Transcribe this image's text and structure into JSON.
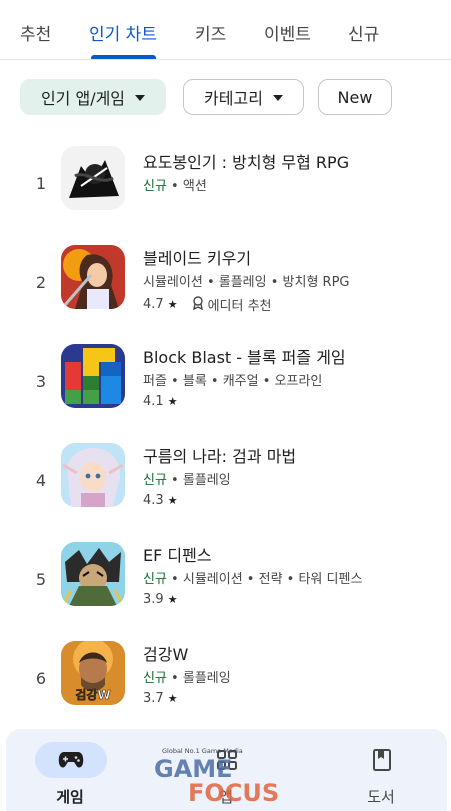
{
  "tabs": [
    {
      "label": "추천"
    },
    {
      "label": "인기 차트"
    },
    {
      "label": "키즈"
    },
    {
      "label": "이벤트"
    },
    {
      "label": "신규"
    }
  ],
  "filters": {
    "category_chip": "인기 앱/게임",
    "category_dropdown": "카테고리",
    "new_chip": "New"
  },
  "apps": [
    {
      "rank": "1",
      "title": "요도봉인기 : 방치형 무협 RPG",
      "tags": [
        "신규",
        "액션"
      ],
      "is_new": true
    },
    {
      "rank": "2",
      "title": "블레이드 키우기",
      "tags": [
        "시뮬레이션",
        "롤플레잉",
        "방치형 RPG"
      ],
      "is_new": false,
      "rating": "4.7",
      "badge": "에디터 추천"
    },
    {
      "rank": "3",
      "title": "Block Blast - 블록 퍼즐 게임",
      "tags": [
        "퍼즐",
        "블록",
        "캐주얼",
        "오프라인"
      ],
      "is_new": false,
      "rating": "4.1"
    },
    {
      "rank": "4",
      "title": "구름의 나라: 검과 마법",
      "tags": [
        "신규",
        "롤플레잉"
      ],
      "is_new": true,
      "rating": "4.3"
    },
    {
      "rank": "5",
      "title": "EF 디펜스",
      "tags": [
        "신규",
        "시뮬레이션",
        "전략",
        "타워 디펜스"
      ],
      "is_new": true,
      "rating": "3.9"
    },
    {
      "rank": "6",
      "title": "검강W",
      "tags": [
        "신규",
        "롤플레잉"
      ],
      "is_new": true,
      "rating": "3.7"
    }
  ],
  "icon6_text": "검강W",
  "bottom_nav": [
    {
      "label": "게임",
      "icon": "gamepad-icon",
      "active": true
    },
    {
      "label": "앱",
      "icon": "apps-grid-icon",
      "active": false
    },
    {
      "label": "도서",
      "icon": "book-icon",
      "active": false
    }
  ],
  "watermark": {
    "tagline": "Global No.1 Game Media",
    "line1": "GAME",
    "line2": "FOCUS"
  },
  "colors": {
    "accent": "#0b57d0",
    "new_tag": "#146c2e",
    "chip_selected": "#e2f1ec",
    "nav_bg": "#eef2fa",
    "nav_active": "#d3e3fd"
  }
}
